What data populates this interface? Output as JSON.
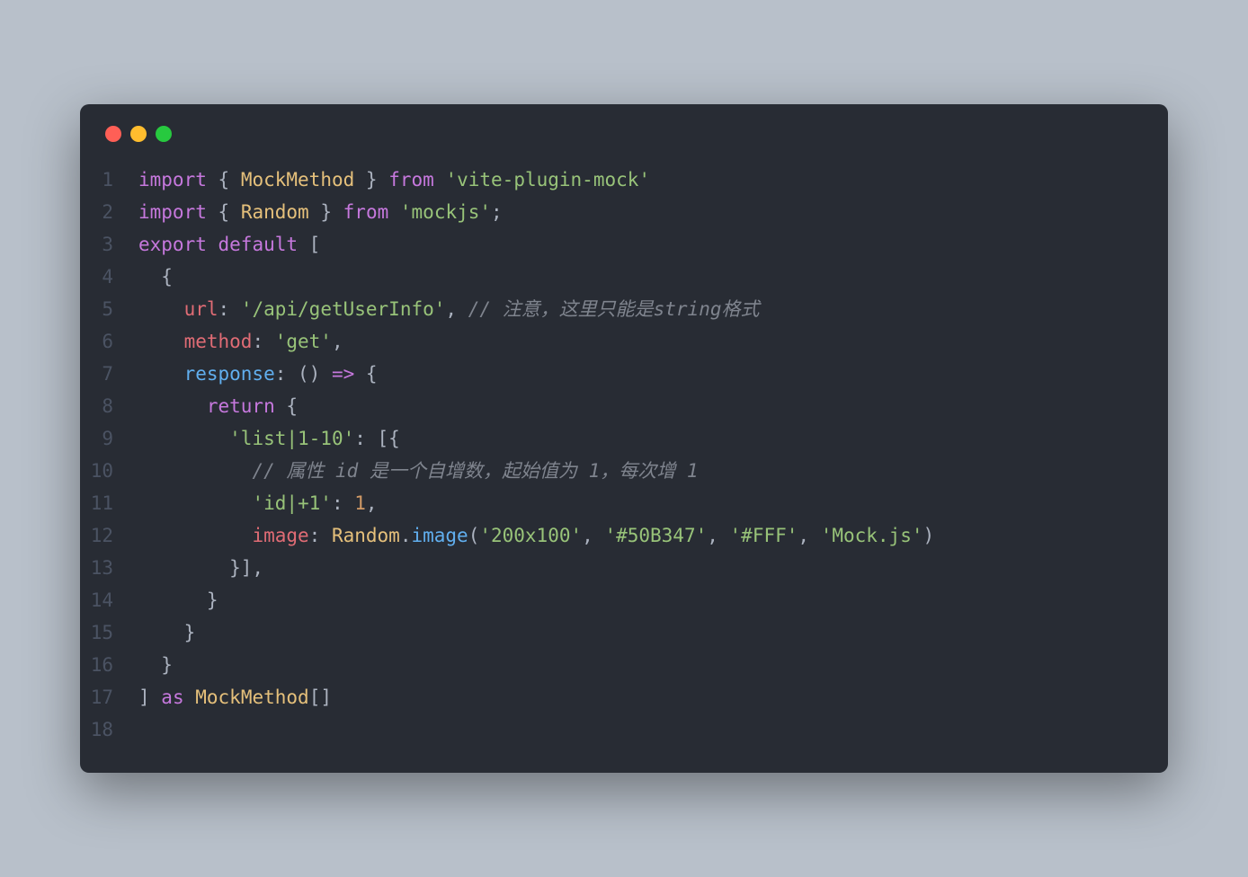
{
  "window": {
    "trafficLights": [
      "red",
      "yellow",
      "green"
    ]
  },
  "code": {
    "lines": [
      {
        "num": "1",
        "tokens": [
          {
            "t": "import",
            "c": "kw"
          },
          {
            "t": " ",
            "c": "punc"
          },
          {
            "t": "{",
            "c": "punc"
          },
          {
            "t": " ",
            "c": "punc"
          },
          {
            "t": "MockMethod",
            "c": "cls"
          },
          {
            "t": " ",
            "c": "punc"
          },
          {
            "t": "}",
            "c": "punc"
          },
          {
            "t": " ",
            "c": "punc"
          },
          {
            "t": "from",
            "c": "kw"
          },
          {
            "t": " ",
            "c": "punc"
          },
          {
            "t": "'vite-plugin-mock'",
            "c": "str"
          }
        ]
      },
      {
        "num": "2",
        "tokens": [
          {
            "t": "import",
            "c": "kw"
          },
          {
            "t": " ",
            "c": "punc"
          },
          {
            "t": "{",
            "c": "punc"
          },
          {
            "t": " ",
            "c": "punc"
          },
          {
            "t": "Random",
            "c": "cls"
          },
          {
            "t": " ",
            "c": "punc"
          },
          {
            "t": "}",
            "c": "punc"
          },
          {
            "t": " ",
            "c": "punc"
          },
          {
            "t": "from",
            "c": "kw"
          },
          {
            "t": " ",
            "c": "punc"
          },
          {
            "t": "'mockjs'",
            "c": "str"
          },
          {
            "t": ";",
            "c": "punc"
          }
        ]
      },
      {
        "num": "3",
        "tokens": [
          {
            "t": "export",
            "c": "kw"
          },
          {
            "t": " ",
            "c": "punc"
          },
          {
            "t": "default",
            "c": "kw"
          },
          {
            "t": " [",
            "c": "punc"
          }
        ]
      },
      {
        "num": "4",
        "tokens": [
          {
            "t": "  {",
            "c": "punc"
          }
        ]
      },
      {
        "num": "5",
        "tokens": [
          {
            "t": "    ",
            "c": "punc"
          },
          {
            "t": "url",
            "c": "prop"
          },
          {
            "t": ": ",
            "c": "punc"
          },
          {
            "t": "'/api/getUserInfo'",
            "c": "str"
          },
          {
            "t": ", ",
            "c": "punc"
          },
          {
            "t": "// 注意，这里只能是string格式",
            "c": "cmt"
          }
        ]
      },
      {
        "num": "6",
        "tokens": [
          {
            "t": "    ",
            "c": "punc"
          },
          {
            "t": "method",
            "c": "prop"
          },
          {
            "t": ": ",
            "c": "punc"
          },
          {
            "t": "'get'",
            "c": "str"
          },
          {
            "t": ",",
            "c": "punc"
          }
        ]
      },
      {
        "num": "7",
        "tokens": [
          {
            "t": "    ",
            "c": "punc"
          },
          {
            "t": "response",
            "c": "fn"
          },
          {
            "t": ": ",
            "c": "punc"
          },
          {
            "t": "()",
            "c": "punc"
          },
          {
            "t": " ",
            "c": "punc"
          },
          {
            "t": "=>",
            "c": "kw"
          },
          {
            "t": " {",
            "c": "punc"
          }
        ]
      },
      {
        "num": "8",
        "tokens": [
          {
            "t": "      ",
            "c": "punc"
          },
          {
            "t": "return",
            "c": "kw"
          },
          {
            "t": " {",
            "c": "punc"
          }
        ]
      },
      {
        "num": "9",
        "tokens": [
          {
            "t": "        ",
            "c": "punc"
          },
          {
            "t": "'list|1-10'",
            "c": "str"
          },
          {
            "t": ": [{",
            "c": "punc"
          }
        ]
      },
      {
        "num": "10",
        "tokens": [
          {
            "t": "          ",
            "c": "punc"
          },
          {
            "t": "// 属性 id 是一个自增数，起始值为 1，每次增 1",
            "c": "cmt"
          }
        ]
      },
      {
        "num": "11",
        "tokens": [
          {
            "t": "          ",
            "c": "punc"
          },
          {
            "t": "'id|+1'",
            "c": "str"
          },
          {
            "t": ": ",
            "c": "punc"
          },
          {
            "t": "1",
            "c": "num"
          },
          {
            "t": ",",
            "c": "punc"
          }
        ]
      },
      {
        "num": "12",
        "tokens": [
          {
            "t": "          ",
            "c": "punc"
          },
          {
            "t": "image",
            "c": "prop"
          },
          {
            "t": ": ",
            "c": "punc"
          },
          {
            "t": "Random",
            "c": "cls"
          },
          {
            "t": ".",
            "c": "punc"
          },
          {
            "t": "image",
            "c": "fn"
          },
          {
            "t": "(",
            "c": "punc"
          },
          {
            "t": "'200x100'",
            "c": "str"
          },
          {
            "t": ", ",
            "c": "punc"
          },
          {
            "t": "'#50B347'",
            "c": "str"
          },
          {
            "t": ", ",
            "c": "punc"
          },
          {
            "t": "'#FFF'",
            "c": "str"
          },
          {
            "t": ", ",
            "c": "punc"
          },
          {
            "t": "'Mock.js'",
            "c": "str"
          },
          {
            "t": ")",
            "c": "punc"
          }
        ]
      },
      {
        "num": "13",
        "tokens": [
          {
            "t": "        }],",
            "c": "punc"
          }
        ]
      },
      {
        "num": "14",
        "tokens": [
          {
            "t": "      }",
            "c": "punc"
          }
        ]
      },
      {
        "num": "15",
        "tokens": [
          {
            "t": "    }",
            "c": "punc"
          }
        ]
      },
      {
        "num": "16",
        "tokens": [
          {
            "t": "  }",
            "c": "punc"
          }
        ]
      },
      {
        "num": "17",
        "tokens": [
          {
            "t": "] ",
            "c": "punc"
          },
          {
            "t": "as",
            "c": "kw"
          },
          {
            "t": " ",
            "c": "punc"
          },
          {
            "t": "MockMethod",
            "c": "cls"
          },
          {
            "t": "[]",
            "c": "punc"
          }
        ]
      },
      {
        "num": "18",
        "tokens": []
      }
    ]
  }
}
